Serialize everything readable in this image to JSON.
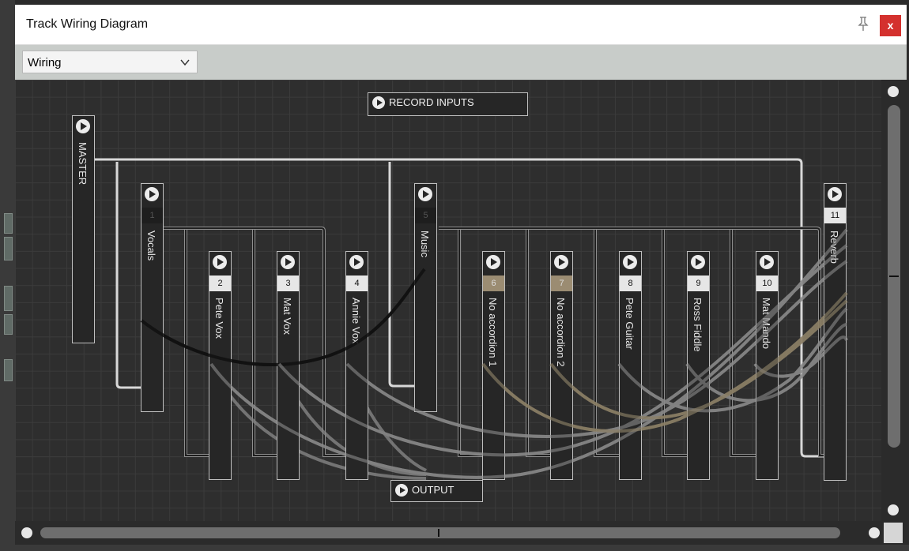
{
  "window": {
    "title": "Track Wiring Diagram",
    "close_label": "x"
  },
  "toolbar": {
    "view_mode": "Wiring"
  },
  "canvas": {
    "record_inputs_label": "RECORD INPUTS",
    "output_label": "OUTPUT",
    "master_label": "MASTER",
    "tracks": [
      {
        "num": "1",
        "name": "Vocals"
      },
      {
        "num": "2",
        "name": "Pete Vox"
      },
      {
        "num": "3",
        "name": "Mat Vox"
      },
      {
        "num": "4",
        "name": "Annie Vox"
      },
      {
        "num": "5",
        "name": "Music"
      },
      {
        "num": "6",
        "name": "No accordion 1"
      },
      {
        "num": "7",
        "name": "No accordion 2"
      },
      {
        "num": "8",
        "name": "Pete Guitar"
      },
      {
        "num": "9",
        "name": "Ross Fiddle"
      },
      {
        "num": "10",
        "name": "Mat Mando"
      },
      {
        "num": "11",
        "name": "Reverb"
      }
    ]
  },
  "colors": {
    "window_title_bg": "#ffffff",
    "toolbar_bg": "#c8ccc9",
    "canvas_bg": "#2e2e2e",
    "close_button": "#d4312e",
    "wire_main": "#d8d8d8",
    "wire_send": "#8a8a8a",
    "wire_send_tan": "#8b7f66"
  }
}
